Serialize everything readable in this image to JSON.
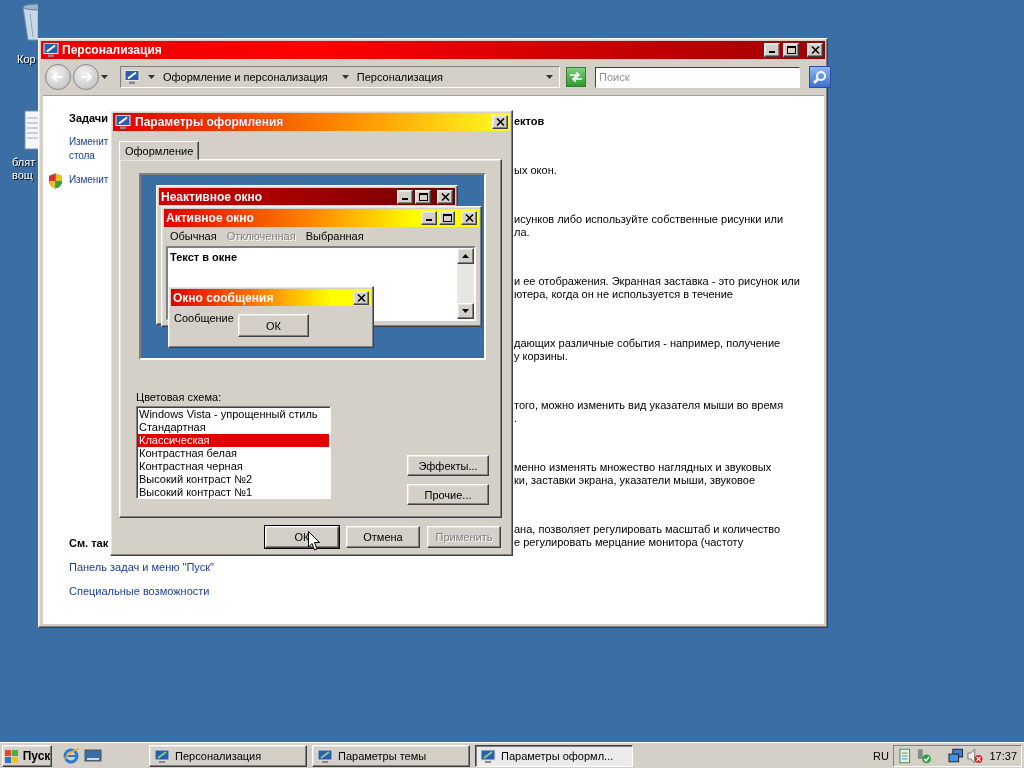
{
  "desktop_icons": [
    {
      "kind": "recycle-bin",
      "lines": [
        "Кор"
      ]
    },
    {
      "kind": "document",
      "lines": [
        "блят",
        "вощ"
      ]
    }
  ],
  "main_window": {
    "title": "Персонализация",
    "breadcrumb": [
      "Оформление и персонализация",
      "Персонализация"
    ],
    "search": {
      "placeholder": "Поиск"
    },
    "tasks_heading": "Задачи",
    "task_links": [
      {
        "kind": "plain",
        "lines": [
          "Изменит",
          "стола"
        ]
      },
      {
        "kind": "shield",
        "lines": [
          "Изменит"
        ]
      }
    ],
    "see_also_heading": "См. так",
    "see_also_links": [
      "Панель задач и меню \"Пуск\"",
      "Специальные возможности"
    ],
    "right_fragments": [
      {
        "kind": "heading",
        "lines": [
          "ектов"
        ]
      },
      {
        "kind": "text",
        "lines": [
          "ых окон."
        ]
      },
      {
        "kind": "text",
        "lines": [
          "исунков либо используйте собственные рисунки или",
          "ла."
        ]
      },
      {
        "kind": "text",
        "lines": [
          "и ее отображения. Экранная заставка - это рисунок или",
          "ютера, когда он не используется в течение"
        ]
      },
      {
        "kind": "text",
        "lines": [
          "дающих различные события - например, получение",
          "у корзины."
        ]
      },
      {
        "kind": "text",
        "lines": [
          "того, можно изменить вид указателя мыши во время",
          "."
        ]
      },
      {
        "kind": "text",
        "lines": [
          "менно изменять множество наглядных и звуковых",
          "ки, заставки экрана, указатели мыши, звуковое"
        ]
      },
      {
        "kind": "text",
        "lines": [
          "ана, позволяет регулировать масштаб и количество",
          "е регулировать мерцание монитора (частоту"
        ]
      }
    ]
  },
  "dialog": {
    "title": "Параметры оформления",
    "tabs": [
      {
        "label": "Оформление",
        "selected": true
      }
    ],
    "preview": {
      "inactive_title": "Неактивное окно",
      "active_title": "Активное окно",
      "menu": [
        {
          "label": "Обычная",
          "disabled": false
        },
        {
          "label": "Отключенная",
          "disabled": true
        },
        {
          "label": "Выбранная",
          "disabled": false
        }
      ],
      "window_text": "Текст в окне",
      "message_title": "Окно сообщения",
      "message_text": "Сообщение",
      "message_button": "ОК"
    },
    "scheme_label": "Цветовая схема:",
    "color_schemes": [
      {
        "label": "Windows Vista - упрощенный стиль",
        "selected": false
      },
      {
        "label": "Стандартная",
        "selected": false
      },
      {
        "label": "Классическая",
        "selected": true
      },
      {
        "label": "Контрастная белая",
        "selected": false
      },
      {
        "label": "Контрастная черная",
        "selected": false
      },
      {
        "label": "Высокий контраст №2",
        "selected": false
      },
      {
        "label": "Высокий контраст №1",
        "selected": false
      }
    ],
    "side_buttons": [
      "Эффекты...",
      "Прочие..."
    ],
    "buttons": [
      {
        "label": "ОК",
        "default": true,
        "disabled": false
      },
      {
        "label": "Отмена",
        "default": false,
        "disabled": false
      },
      {
        "label": "Применить",
        "default": false,
        "disabled": true
      }
    ]
  },
  "taskbar": {
    "start_label": "Пуск",
    "tasks": [
      {
        "label": "Персонализация",
        "selected": false
      },
      {
        "label": "Параметры темы",
        "selected": false
      },
      {
        "label": "Параметры оформл...",
        "selected": true
      }
    ],
    "language": "RU",
    "clock": "17:37"
  }
}
